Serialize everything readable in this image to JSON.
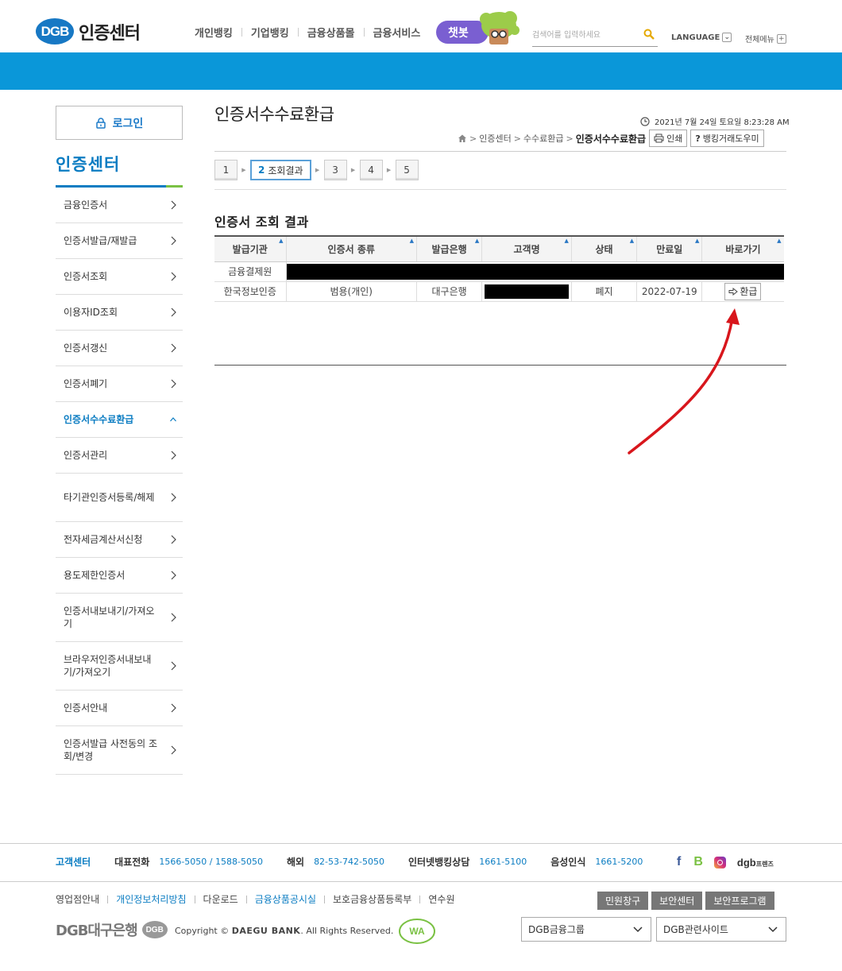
{
  "header": {
    "logo_badge": "DGB",
    "logo_text": "인증센터",
    "nav": [
      "개인뱅킹",
      "기업뱅킹",
      "금융상품몰",
      "금융서비스"
    ],
    "chatbot_label": "챗봇",
    "search_placeholder": "검색어를 입력하세요",
    "language_label": "LANGUAGE",
    "allmenu_label": "전체메뉴"
  },
  "sidebar": {
    "login_label": "로그인",
    "title": "인증센터",
    "items": [
      {
        "label": "금융인증서",
        "active": false
      },
      {
        "label": "인증서발급/재발급",
        "active": false
      },
      {
        "label": "인증서조회",
        "active": false
      },
      {
        "label": "이용자ID조회",
        "active": false
      },
      {
        "label": "인증서갱신",
        "active": false
      },
      {
        "label": "인증서폐기",
        "active": false
      },
      {
        "label": "인증서수수료환급",
        "active": true
      },
      {
        "label": "인증서관리",
        "active": false
      },
      {
        "label": "타기관인증서등록/해제",
        "active": false
      },
      {
        "label": "전자세금계산서신청",
        "active": false
      },
      {
        "label": "용도제한인증서",
        "active": false
      },
      {
        "label": "인증서내보내기/가져오기",
        "active": false
      },
      {
        "label": "브라우저인증서내보내기/가져오기",
        "active": false
      },
      {
        "label": "인증서안내",
        "active": false
      },
      {
        "label": "인증서발급 사전동의 조회/변경",
        "active": false
      }
    ]
  },
  "main": {
    "page_title": "인증서수수료환급",
    "datetime": "2021년 7월 24일 토요일 8:23:28 AM",
    "breadcrumb": [
      "인증센터",
      "수수료환급",
      "인증서수수료환급"
    ],
    "print_label": "인쇄",
    "help_label": "뱅킹거래도우미",
    "steps": [
      {
        "num": "1",
        "label": "",
        "active": false
      },
      {
        "num": "2",
        "label": "조회결과",
        "active": true
      },
      {
        "num": "3",
        "label": "",
        "active": false
      },
      {
        "num": "4",
        "label": "",
        "active": false
      },
      {
        "num": "5",
        "label": "",
        "active": false
      }
    ],
    "section_title": "인증서 조회 결과",
    "table": {
      "headers": [
        "발급기관",
        "인증서 종류",
        "발급은행",
        "고객명",
        "상태",
        "만료일",
        "바로가기"
      ],
      "row1": {
        "issuer": "금융결제원"
      },
      "row2": {
        "issuer": "한국정보인증",
        "type": "범용(개인)",
        "bank": "대구은행",
        "status": "폐지",
        "expiry": "2022-07-19",
        "action": "환급"
      }
    }
  },
  "footer": {
    "center_title": "고객센터",
    "contacts": [
      {
        "label": "대표전화",
        "value": "1566-5050 / 1588-5050"
      },
      {
        "label": "해외",
        "value": "82-53-742-5050"
      },
      {
        "label": "인터넷뱅킹상담",
        "value": "1661-5100"
      },
      {
        "label": "음성인식",
        "value": "1661-5200"
      }
    ],
    "sns": {
      "facebook": "f",
      "blog": "B",
      "dgb": "dgb",
      "dgb_small": "프렌즈"
    },
    "links": [
      {
        "label": "영업점안내",
        "blue": false
      },
      {
        "label": "개인정보처리방침",
        "blue": true
      },
      {
        "label": "다운로드",
        "blue": false
      },
      {
        "label": "금융상품공시실",
        "blue": true
      },
      {
        "label": "보호금융상품등록부",
        "blue": false
      },
      {
        "label": "연수원",
        "blue": false
      }
    ],
    "buttons": [
      "민원창구",
      "보안센터",
      "보안프로그램"
    ],
    "logo_text": "DGB대구은행",
    "logo_badge": "DGB",
    "copyright_prefix": "Copyright ©",
    "copyright_bold": "DAEGU BANK",
    "copyright_suffix": ". All Rights Reserved.",
    "wa_label": "WA",
    "select1": "DGB금융그룹",
    "select2": "DGB관련사이트"
  },
  "colors": {
    "brand_blue": "#0a7cc2",
    "banner": "#0a97d9",
    "chatbot": "#7a5fd1",
    "arrow": "#d8161c"
  }
}
